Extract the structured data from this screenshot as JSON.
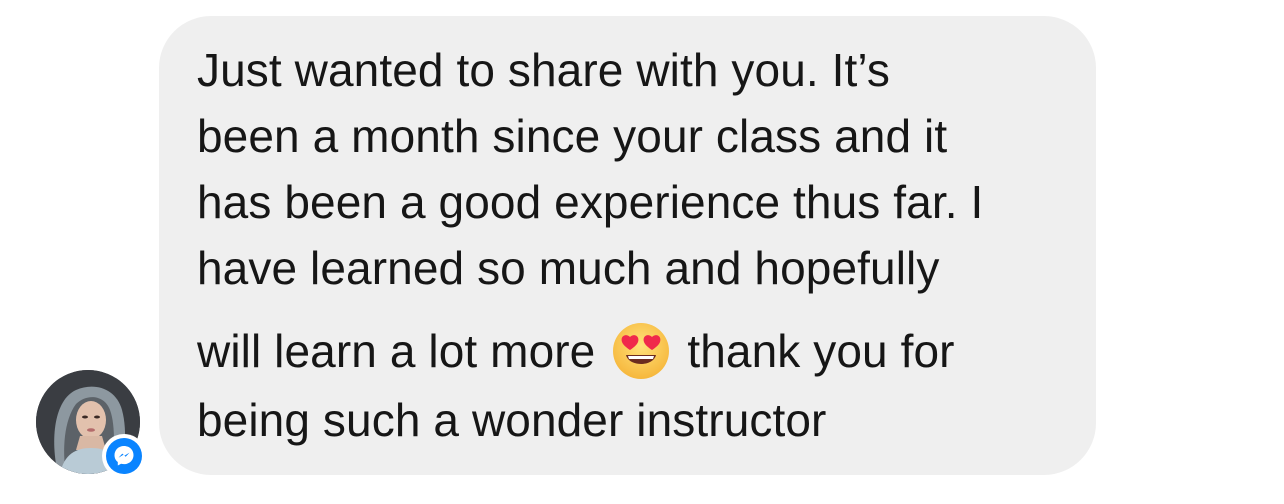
{
  "message": {
    "lines": [
      "Just wanted to share with you. It’s",
      "been a month since your class and it",
      "has been a good experience thus far. I",
      "have learned so much and hopefully",
      "will learn a lot more",
      "thank you for",
      "being such a wonder instructor"
    ],
    "emoji": "heart-eyes-emoji"
  },
  "sender": {
    "avatar": "profile-photo",
    "badge_icon": "messenger-icon",
    "badge_color": "#0a84ff"
  },
  "colors": {
    "bubble_background": "#efefef",
    "text": "#161616"
  }
}
